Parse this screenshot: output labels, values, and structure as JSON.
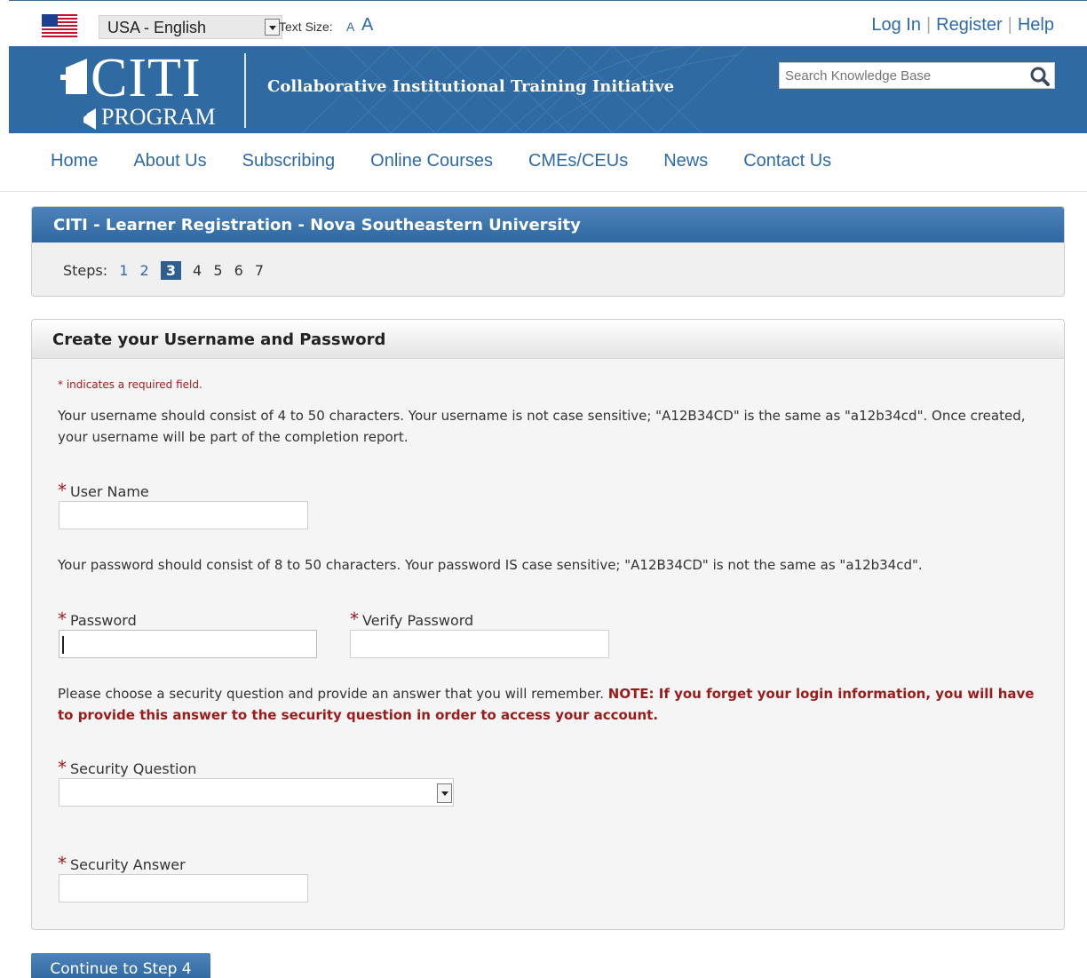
{
  "topbar": {
    "flag_icon": "us-flag-icon",
    "language": "USA - English",
    "text_size_label": "Text Size:",
    "text_size_small": "A",
    "text_size_large": "A",
    "links": [
      "Log In",
      "Register",
      "Help"
    ]
  },
  "banner": {
    "logo_top": "CITI",
    "logo_bottom": "PROGRAM",
    "tagline": "Collaborative Institutional Training Initiative",
    "search_placeholder": "Search Knowledge Base",
    "search_icon": "search-icon"
  },
  "nav": {
    "items": [
      "Home",
      "About Us",
      "Subscribing",
      "Online Courses",
      "CMEs/CEUs",
      "News",
      "Contact Us"
    ]
  },
  "registration": {
    "title": "CITI - Learner Registration - Nova Southeastern University",
    "steps_label": "Steps:",
    "steps": [
      "1",
      "2",
      "3",
      "4",
      "5",
      "6",
      "7"
    ],
    "current_step": "3"
  },
  "form": {
    "title": "Create your Username and Password",
    "required_note": "* indicates a required field.",
    "username_help": "Your username should consist of 4 to 50 characters. Your username is not case sensitive; \"A12B34CD\" is the same as \"a12b34cd\". Once created, your username will be part of the completion report.",
    "required_star": "*",
    "username_label": "User Name",
    "username_value": "",
    "password_help": "Your password should consist of 8 to 50 characters. Your password IS case sensitive; \"A12B34CD\" is not the same as \"a12b34cd\".",
    "password_label": "Password",
    "verify_password_label": "Verify Password",
    "security_help": "Please choose a security question and provide an answer that you will remember.",
    "security_warning": "NOTE: If you forget your login information, you will have to provide this answer to the security question in order to access your account.",
    "security_question_label": "Security Question",
    "security_question_value": "",
    "security_answer_label": "Security Answer",
    "security_answer_value": ""
  },
  "continue_button": "Continue to Step 4",
  "colors": {
    "brand_blue": "#2f6aa3",
    "link_blue": "#2e6aa8",
    "required_red": "#9b1b1b"
  }
}
